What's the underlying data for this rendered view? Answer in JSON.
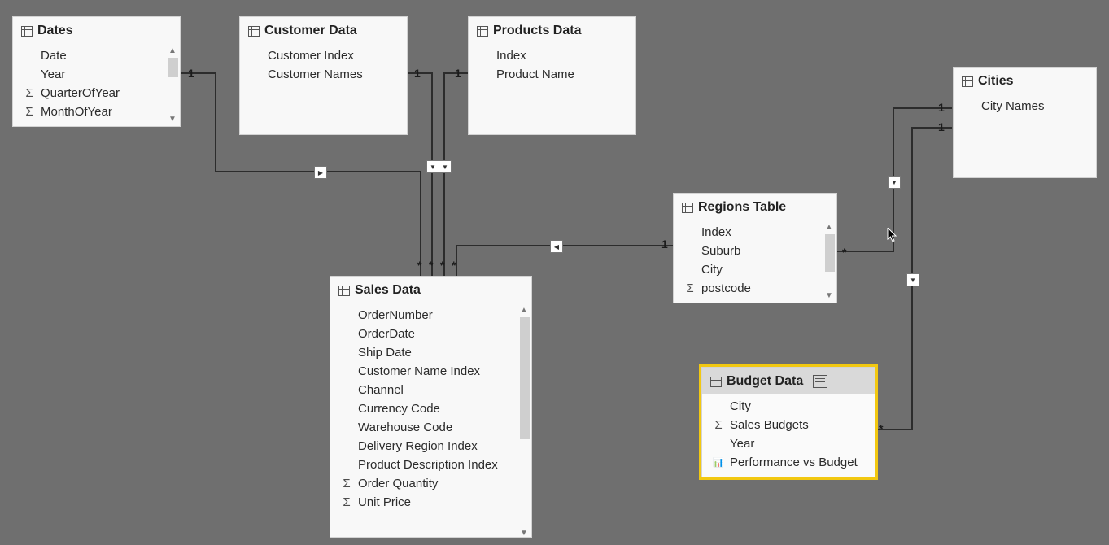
{
  "labels": {
    "one": "1",
    "many": "*"
  },
  "tables": {
    "dates": {
      "title": "Dates",
      "fields": [
        {
          "name": "Date"
        },
        {
          "name": "Year"
        },
        {
          "name": "QuarterOfYear",
          "icon": "sigma"
        },
        {
          "name": "MonthOfYear",
          "icon": "sigma"
        }
      ]
    },
    "customer": {
      "title": "Customer Data",
      "fields": [
        {
          "name": "Customer Index"
        },
        {
          "name": "Customer Names"
        }
      ]
    },
    "products": {
      "title": "Products Data",
      "fields": [
        {
          "name": "Index"
        },
        {
          "name": "Product Name"
        }
      ]
    },
    "cities": {
      "title": "Cities",
      "fields": [
        {
          "name": "City Names"
        }
      ]
    },
    "regions": {
      "title": "Regions Table",
      "fields": [
        {
          "name": "Index"
        },
        {
          "name": "Suburb"
        },
        {
          "name": "City"
        },
        {
          "name": "postcode",
          "icon": "sigma"
        }
      ]
    },
    "sales": {
      "title": "Sales Data",
      "fields": [
        {
          "name": "OrderNumber"
        },
        {
          "name": "OrderDate"
        },
        {
          "name": "Ship Date"
        },
        {
          "name": "Customer Name Index"
        },
        {
          "name": "Channel"
        },
        {
          "name": "Currency Code"
        },
        {
          "name": "Warehouse Code"
        },
        {
          "name": "Delivery Region Index"
        },
        {
          "name": "Product Description Index"
        },
        {
          "name": "Order Quantity",
          "icon": "sigma"
        },
        {
          "name": "Unit Price",
          "icon": "sigma"
        }
      ]
    },
    "budget": {
      "title": "Budget Data",
      "selected": true,
      "fields": [
        {
          "name": "City"
        },
        {
          "name": "Sales Budgets",
          "icon": "sigma"
        },
        {
          "name": "Year"
        },
        {
          "name": "Performance vs Budget",
          "icon": "measure"
        }
      ]
    }
  },
  "relationships": [
    {
      "from": "dates",
      "to": "sales",
      "from_card": "1",
      "to_card": "*"
    },
    {
      "from": "customer",
      "to": "sales",
      "from_card": "1",
      "to_card": "*"
    },
    {
      "from": "products",
      "to": "sales",
      "from_card": "1",
      "to_card": "*"
    },
    {
      "from": "regions",
      "to": "sales",
      "from_card": "1",
      "to_card": "*"
    },
    {
      "from": "cities",
      "to": "regions",
      "from_card": "1",
      "to_card": "*"
    },
    {
      "from": "cities",
      "to": "budget",
      "from_card": "1",
      "to_card": "*"
    }
  ]
}
